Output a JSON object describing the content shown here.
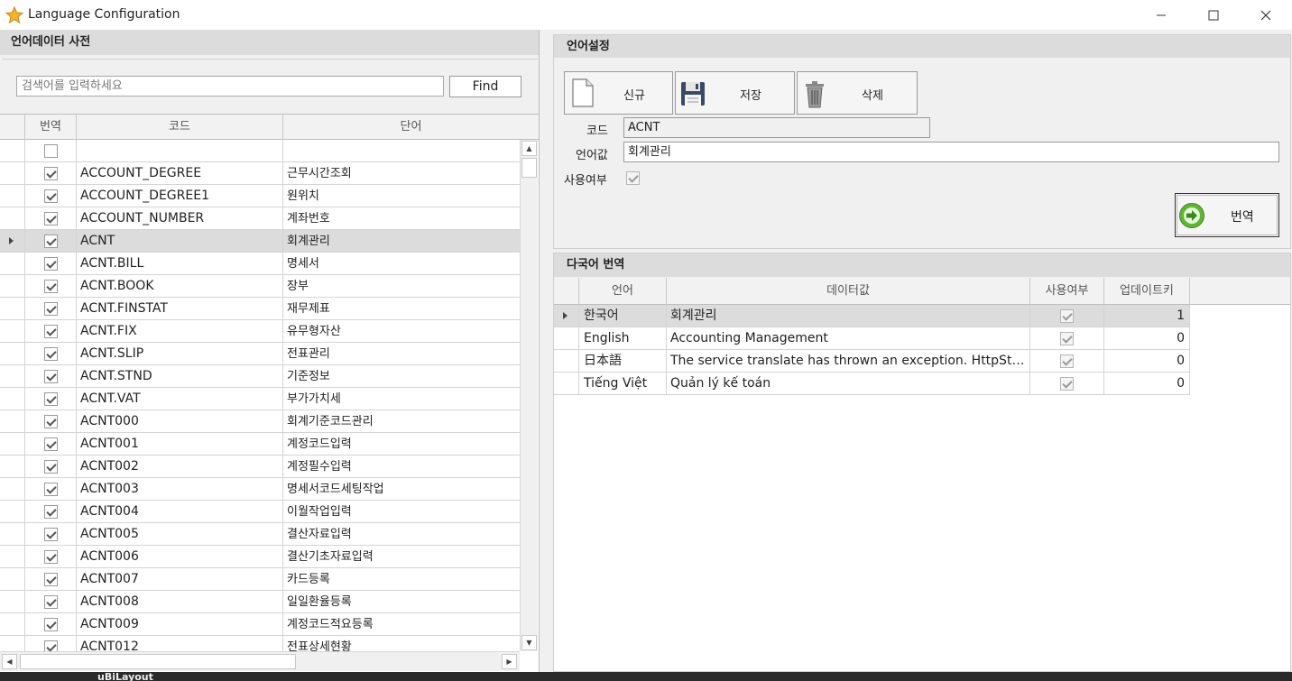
{
  "window": {
    "title": "Language Configuration",
    "app_icon": "star-icon",
    "controls": [
      "minimize-icon",
      "maximize-icon",
      "close-icon"
    ]
  },
  "left_panel": {
    "header": "언어데이터 사전",
    "search": {
      "placeholder": "검색어를 입력하세요",
      "value": ""
    },
    "find_label": "Find",
    "columns": [
      "번역",
      "코드",
      "단어"
    ],
    "rows": [
      {
        "checked": false,
        "code": "",
        "word": ""
      },
      {
        "checked": true,
        "code": "ACCOUNT_DEGREE",
        "word": "근무시간조회"
      },
      {
        "checked": true,
        "code": "ACCOUNT_DEGREE1",
        "word": "원위치"
      },
      {
        "checked": true,
        "code": "ACCOUNT_NUMBER",
        "word": "계좌번호"
      },
      {
        "checked": true,
        "code": "ACNT",
        "word": "회계관리",
        "selected": true
      },
      {
        "checked": true,
        "code": "ACNT.BILL",
        "word": "명세서"
      },
      {
        "checked": true,
        "code": "ACNT.BOOK",
        "word": "장부"
      },
      {
        "checked": true,
        "code": "ACNT.FINSTAT",
        "word": "재무제표"
      },
      {
        "checked": true,
        "code": "ACNT.FIX",
        "word": "유무형자산"
      },
      {
        "checked": true,
        "code": "ACNT.SLIP",
        "word": "전표관리"
      },
      {
        "checked": true,
        "code": "ACNT.STND",
        "word": "기준정보"
      },
      {
        "checked": true,
        "code": "ACNT.VAT",
        "word": "부가가치세"
      },
      {
        "checked": true,
        "code": "ACNT000",
        "word": "회계기준코드관리"
      },
      {
        "checked": true,
        "code": "ACNT001",
        "word": "계정코드입력"
      },
      {
        "checked": true,
        "code": "ACNT002",
        "word": "계정필수입력"
      },
      {
        "checked": true,
        "code": "ACNT003",
        "word": "명세서코드세팅작업"
      },
      {
        "checked": true,
        "code": "ACNT004",
        "word": "이월작업입력"
      },
      {
        "checked": true,
        "code": "ACNT005",
        "word": "결산자료입력"
      },
      {
        "checked": true,
        "code": "ACNT006",
        "word": "결산기초자료입력"
      },
      {
        "checked": true,
        "code": "ACNT007",
        "word": "카드등록"
      },
      {
        "checked": true,
        "code": "ACNT008",
        "word": "일일환율등록"
      },
      {
        "checked": true,
        "code": "ACNT009",
        "word": "계정코드적요등록"
      },
      {
        "checked": true,
        "code": "ACNT012",
        "word": "전표상세현황"
      }
    ]
  },
  "settings_panel": {
    "header": "언어설정",
    "buttons": {
      "new": "신규",
      "save": "저장",
      "delete": "삭제"
    },
    "code_label": "코드",
    "code_value": "ACNT",
    "lang_value_label": "언어값",
    "lang_value": "회계관리",
    "use_label": "사용여부",
    "use_checked": true,
    "translate_label": "번역"
  },
  "translation_panel": {
    "header": "다국어 번역",
    "columns": [
      "언어",
      "데이터값",
      "사용여부",
      "업데이트키"
    ],
    "rows": [
      {
        "lang": "한국어",
        "value": "회계관리",
        "use": true,
        "update_key": "1",
        "selected": true
      },
      {
        "lang": "English",
        "value": "Accounting Management",
        "use": true,
        "update_key": "0"
      },
      {
        "lang": "日本語",
        "value": "The service translate has thrown an exception. HttpStatus...",
        "use": true,
        "update_key": "0"
      },
      {
        "lang": "Tiếng Việt",
        "value": "Quản lý kế toán",
        "use": true,
        "update_key": "0"
      }
    ]
  },
  "taskbar": {
    "label": "uBiLayout"
  },
  "colors": {
    "selected_row": "#dcdcdc",
    "panel_header": "#dcdcdc",
    "translate_icon": "#5cb82e"
  }
}
